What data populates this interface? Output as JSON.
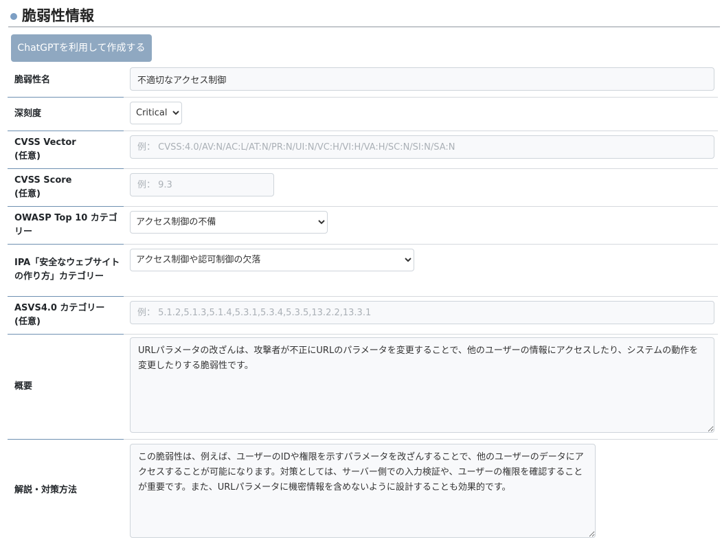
{
  "header": {
    "title": "脆弱性情報"
  },
  "toolbar": {
    "gpt_label": "ChatGPTを利用して作成する"
  },
  "fields": {
    "name": {
      "label": "脆弱性名",
      "value": "不適切なアクセス制御"
    },
    "severity": {
      "label": "深刻度",
      "value": "Critical"
    },
    "cvss_vector": {
      "label": "CVSS Vector\n(任意)",
      "placeholder": "例： CVSS:4.0/AV:N/AC:L/AT:N/PR:N/UI:N/VC:H/VI:H/VA:H/SC:N/SI:N/SA:N"
    },
    "cvss_score": {
      "label": "CVSS Score\n(任意)",
      "placeholder": "例： 9.3"
    },
    "owasp": {
      "label": "OWASP Top 10 カテゴリー",
      "value": "アクセス制御の不備"
    },
    "ipa": {
      "label": "IPA「安全なウェブサイトの作り方」カテゴリー",
      "value": "アクセス制御や認可制御の欠落"
    },
    "asvs": {
      "label": "ASVS4.0 カテゴリー\n(任意)",
      "placeholder": "例： 5.1.2,5.1.3,5.1.4,5.3.1,5.3.4,5.3.5,13.2.2,13.3.1"
    },
    "summary": {
      "label": "概要",
      "value": "URLパラメータの改ざんは、攻撃者が不正にURLのパラメータを変更することで、他のユーザーの情報にアクセスしたり、システムの動作を変更したりする脆弱性です。"
    },
    "explanation": {
      "label": "解説・対策方法",
      "value": "この脆弱性は、例えば、ユーザーのIDや権限を示すパラメータを改ざんすることで、他のユーザーのデータにアクセスすることが可能になります。対策としては、サーバー側での入力検証や、ユーザーの権限を確認することが重要です。また、URLパラメータに機密情報を含めないように設計することも効果的です。"
    }
  }
}
